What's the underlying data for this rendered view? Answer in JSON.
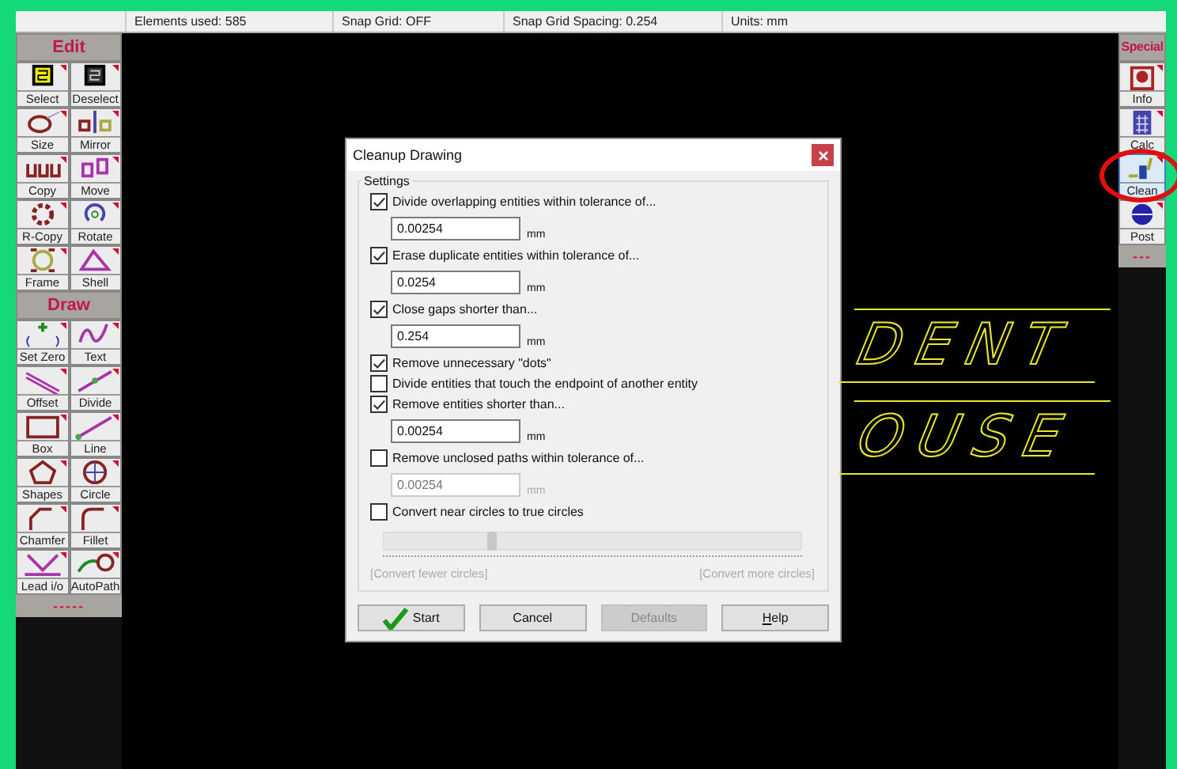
{
  "status_bar": [
    "Elements used: 585",
    "Snap Grid: OFF",
    "Snap Grid Spacing: 0.254",
    "Units: mm"
  ],
  "left_toolbox": [
    {
      "title": "Edit",
      "tools": [
        {
          "label": "Select"
        },
        {
          "label": "Deselect"
        },
        {
          "label": "Size"
        },
        {
          "label": "Mirror"
        },
        {
          "label": "Copy"
        },
        {
          "label": "Move"
        },
        {
          "label": "R-Copy"
        },
        {
          "label": "Rotate"
        },
        {
          "label": "Frame"
        },
        {
          "label": "Shell"
        }
      ]
    },
    {
      "title": "Draw",
      "tools": [
        {
          "label": "Set Zero"
        },
        {
          "label": "Text"
        },
        {
          "label": "Offset"
        },
        {
          "label": "Divide"
        },
        {
          "label": "Box"
        },
        {
          "label": "Line"
        },
        {
          "label": "Shapes"
        },
        {
          "label": "Circle"
        },
        {
          "label": "Chamfer"
        },
        {
          "label": "Fillet"
        },
        {
          "label": "Lead i/o"
        },
        {
          "label": "AutoPath"
        }
      ]
    }
  ],
  "left_toolbox_footer": "-----",
  "right_toolbox": {
    "title": "Special",
    "tools": [
      {
        "label": "Info",
        "selected": false
      },
      {
        "label": "Calc",
        "selected": false
      },
      {
        "label": "Clean",
        "selected": true
      },
      {
        "label": "Post",
        "selected": false
      }
    ],
    "footer": "---"
  },
  "canvas_text": [
    "DENT",
    "OUSE"
  ],
  "dialog": {
    "title": "Cleanup Drawing",
    "group": "Settings",
    "settings": [
      {
        "label": "Divide overlapping entities within tolerance of...",
        "checked": true,
        "value": "0.00254",
        "unit": "mm"
      },
      {
        "label": "Erase duplicate entities within tolerance of...",
        "checked": true,
        "value": "0.0254",
        "unit": "mm"
      },
      {
        "label": "Close gaps shorter than...",
        "checked": true,
        "value": "0.254",
        "unit": "mm"
      },
      {
        "label": "Remove unnecessary \"dots\"",
        "checked": true
      },
      {
        "label": "Divide entities that touch the endpoint of another entity",
        "checked": false
      },
      {
        "label": "Remove entities shorter than...",
        "checked": true,
        "value": "0.00254",
        "unit": "mm"
      },
      {
        "label": "Remove unclosed paths within tolerance of...",
        "checked": false,
        "value": "0.00254",
        "unit": "mm"
      },
      {
        "label": "Convert near circles to true circles",
        "checked": false
      }
    ],
    "slider": {
      "level": 0.26,
      "disabled": true,
      "min_label": "[Convert fewer circles]",
      "max_label": "[Convert more circles]"
    },
    "buttons": [
      {
        "kind": "start",
        "label": "Start",
        "disabled": false
      },
      {
        "kind": "plain",
        "label": "Cancel",
        "disabled": false
      },
      {
        "kind": "plain",
        "label": "Defaults",
        "disabled": true
      },
      {
        "kind": "mnemonic",
        "label": "Help",
        "disabled": false
      }
    ]
  }
}
